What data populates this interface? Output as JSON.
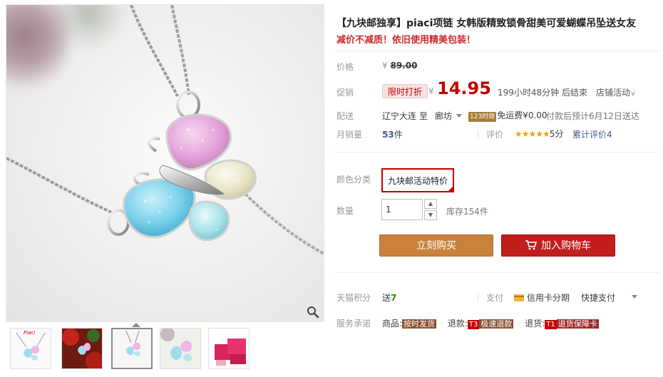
{
  "gallery": {
    "thumbnails": [
      "necklace-front",
      "necklace-red-flowers",
      "necklace-selected",
      "necklace-closeup",
      "red-gift-box"
    ],
    "thumb1_caption": "Piaci",
    "active_index": 2
  },
  "product": {
    "title": "【九块邮独享】piaci项链 女韩版精致锁骨甜美可爱蝴蝶吊坠送女友",
    "subtitle": "减价不减质！依旧使用精美包装！"
  },
  "price": {
    "label": "价格",
    "original_currency": "¥",
    "original": "89.00",
    "promo_label": "促销",
    "promo_tag": "限时打折",
    "promo_currency": "¥",
    "promo_price": "14.95",
    "countdown": "199小时48分钟 后结束",
    "store_activity": "店铺活动",
    "store_activity_arrow": "v"
  },
  "shipping": {
    "label": "配送",
    "from": "辽宁大连",
    "to_word": "至",
    "to": "廊坊",
    "badge": "123时效",
    "fee": "免运费¥0.00",
    "eta": "付款后预计6月12日送达"
  },
  "sales": {
    "label": "月销量",
    "count": "53",
    "unit": "件",
    "review_label": "评价",
    "stars": "★★★★★",
    "score": "5分",
    "total_reviews": "累计评价4"
  },
  "sku": {
    "label": "颜色分类",
    "selected": "九块邮活动特价"
  },
  "quantity": {
    "label": "数量",
    "value": "1",
    "stock": "库存154件"
  },
  "buttons": {
    "buy_now": "立刻购买",
    "add_to_cart": "加入购物车"
  },
  "points": {
    "label": "天猫积分",
    "gift": "送",
    "amount": "7"
  },
  "payment": {
    "label": "支付",
    "credit": "信用卡分期",
    "quick": "快捷支付"
  },
  "service": {
    "label": "服务承诺",
    "goods_label": "商品:",
    "goods_tag": "按时发货",
    "refund_label": "退款:",
    "refund_num": "T3",
    "refund_tag": "极速退款",
    "return_label": "退货:",
    "return_num": "T1",
    "return_tag": "退货保障卡"
  },
  "colors": {
    "accent_red": "#c40000",
    "buy_orange": "#c9813b",
    "cart_red": "#c21e1e",
    "link_blue": "#3c5a96",
    "star_gold": "#f2a100"
  },
  "icons": [
    "zoom-icon",
    "cart-icon",
    "credit-card-icon",
    "chevron-down-icon",
    "spin-up-icon",
    "spin-down-icon",
    "check-corner-icon"
  ]
}
